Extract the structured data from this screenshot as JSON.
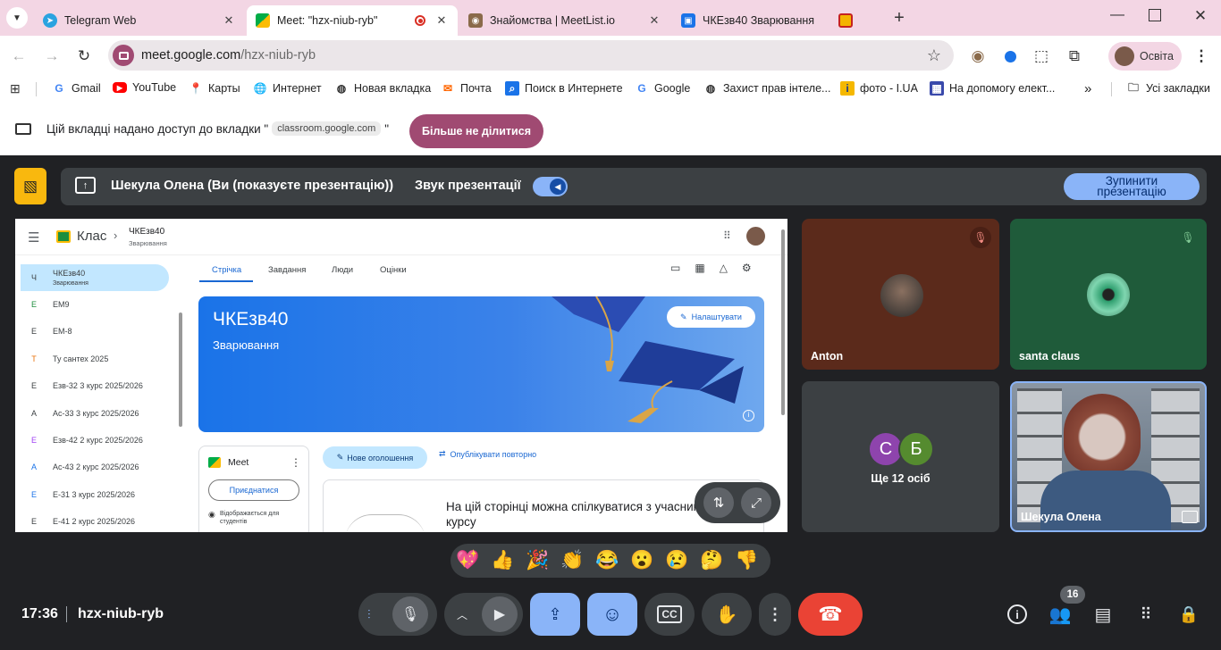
{
  "browser": {
    "tabs": [
      {
        "title": "Telegram Web",
        "icon": "telegram-icon"
      },
      {
        "title": "Meet: \"hzx-niub-ryb\"",
        "icon": "meet-icon"
      },
      {
        "title": "Знайомства | MeetList.io",
        "icon": "owl-icon"
      },
      {
        "title": "ЧКЕзв40 Зварювання",
        "icon": "classroom-icon"
      },
      {
        "title": "",
        "icon": "slides-icon"
      }
    ],
    "url_host": "meet.google.com",
    "url_path": "/hzx-niub-ryb",
    "profile_label": "Освіта",
    "bookmarks": [
      "Gmail",
      "YouTube",
      "Карты",
      "Интернет",
      "Новая вкладка",
      "Почта",
      "Поиск в Интернете",
      "Google",
      "Захист прав інтеле...",
      "фото - I.UA",
      "На допомогу елект..."
    ],
    "all_bookmarks": "Усі закладки"
  },
  "sharebar": {
    "text": "Цій вкладці надано доступ до вкладки \"",
    "chip": "classroom.google.com",
    "quote_end": "\"",
    "stop_button": "Більше не ділитися"
  },
  "meet": {
    "presenter_text": "Шекула Олена (Ви (показуєте презентацію))",
    "sound_label": "Звук презентації",
    "stop_presenting": "Зупинити презентацію",
    "participants": [
      {
        "name": "Anton",
        "muted": true,
        "bg": "#5b2a1b"
      },
      {
        "name": "santa claus",
        "muted": true,
        "bg": "#1f5b3a"
      },
      {
        "name": "Шекула Олена",
        "muted": false,
        "bg": "#6e7a88"
      }
    ],
    "others": {
      "avatars": [
        "С",
        "Б"
      ],
      "label": "Ще 12 осіб"
    },
    "reactions": [
      "💖",
      "👍",
      "🎉",
      "👏",
      "😂",
      "😮",
      "😢",
      "🤔",
      "👎"
    ],
    "time": "17:36",
    "meeting_code": "hzx-niub-ryb",
    "participant_count": "16"
  },
  "classroom": {
    "app": "Клас",
    "class_name": "ЧКЕзв40",
    "class_subtitle": "Зварювання",
    "sidebar": [
      {
        "letter": "Ч",
        "name": "ЧКЕзв40",
        "sub": "Зварювання",
        "active": true
      },
      {
        "letter": "Е",
        "name": "ЕМ9"
      },
      {
        "letter": "Е",
        "name": "ЕМ-8"
      },
      {
        "letter": "Т",
        "name": "Ту сантех 2025"
      },
      {
        "letter": "Е",
        "name": "Езв-32 3 курс 2025/2026"
      },
      {
        "letter": "А",
        "name": "Ас-33 3 курс 2025/2026"
      },
      {
        "letter": "Е",
        "name": "Езв-42 2 курс 2025/2026"
      },
      {
        "letter": "А",
        "name": "Ас-43 2 курс 2025/2026"
      },
      {
        "letter": "Е",
        "name": "Е-31 3 курс 2025/2026"
      },
      {
        "letter": "Е",
        "name": "Е-41 2 курс 2025/2026"
      }
    ],
    "tabs": [
      "Стрічка",
      "Завдання",
      "Люди",
      "Оцінки"
    ],
    "banner_title": "ЧКЕзв40",
    "banner_subtitle": "Зварювання",
    "customize": "Налаштувати",
    "meet_card_title": "Meet",
    "join_button": "Приєднатися",
    "visible_text": "Відображається для студентів",
    "new_announcement": "Нове оголошення",
    "republish": "Опублікувати повторно",
    "info_text": "На цій сторінці можна спілкуватися з учасниками курсу"
  }
}
